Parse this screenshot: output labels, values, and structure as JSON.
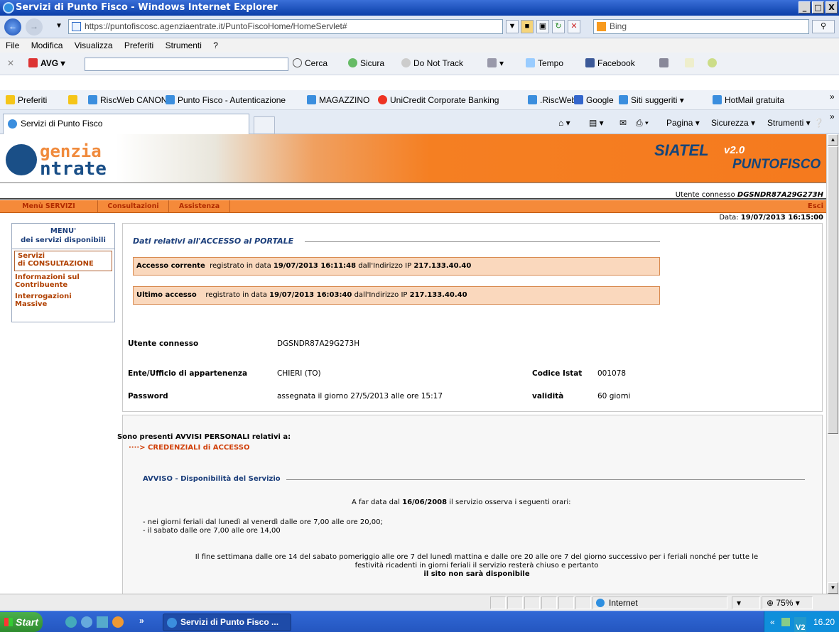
{
  "window": {
    "title": "Servizi di Punto Fisco - Windows Internet Explorer",
    "min": "_",
    "max": "×",
    "close": "X"
  },
  "browser": {
    "url": "https://puntofiscosc.agenziaentrate.it/PuntoFiscoHome/HomeServlet#",
    "search_placeholder": "Bing",
    "menu": [
      "File",
      "Modifica",
      "Visualizza",
      "Preferiti",
      "Strumenti",
      "?"
    ],
    "avg": {
      "label": "AVG",
      "cerca": "Cerca",
      "sicura": "Sicura",
      "dnt": "Do Not Track",
      "tempo": "Tempo",
      "facebook": "Facebook"
    },
    "favorites": {
      "label": "Preferiti",
      "items": [
        "RiscWeb CANONI",
        "Punto Fisco - Autenticazione",
        "MAGAZZINO",
        "UniCredit Corporate Banking",
        ".RiscWeb",
        "Google",
        "Siti suggeriti ▾",
        "HotMail gratuita"
      ]
    },
    "tab": "Servizi di Punto Fisco",
    "commands": {
      "pagina": "Pagina ▾",
      "sicurezza": "Sicurezza ▾",
      "strumenti": "Strumenti ▾"
    }
  },
  "site": {
    "logo_top": "genzia",
    "logo_bottom": "ntrate",
    "brand_siatel": "SIATEL",
    "brand_version": "v2.0",
    "brand_punto": "PUNTOFISCO",
    "user_line_label": "Utente connesso",
    "user_line_value": "DGSNDR87A29G273H",
    "nav": [
      "Menù SERVIZI",
      "Consultazioni",
      "Assistenza"
    ],
    "esci": "Esci",
    "date_label": "Data:",
    "date_value": "19/07/2013 16:15:00"
  },
  "sidebar": {
    "title1": "MENU'",
    "title2": "dei servizi disponibili",
    "items": [
      {
        "line1": "Servizi",
        "line2": "di CONSULTAZIONE"
      },
      {
        "line1": "Informazioni sul",
        "line2": "Contribuente"
      },
      {
        "line1": "Interrogazioni",
        "line2": "Massive"
      }
    ]
  },
  "access": {
    "legend": "Dati relativi all'ACCESSO al PORTALE",
    "current": {
      "label": "Accesso corrente",
      "text": "registrato in data",
      "date": "19/07/2013 16:11:48",
      "ip_text": "dall'Indirizzo IP",
      "ip": "217.133.40.40"
    },
    "last": {
      "label": "Ultimo accesso",
      "text": "registrato in data",
      "date": "19/07/2013 16:03:40",
      "ip_text": "dall'Indirizzo IP",
      "ip": "217.133.40.40"
    }
  },
  "info": {
    "utente_label": "Utente connesso",
    "utente_value": "DGSNDR87A29G273H",
    "ente_label": "Ente/Ufficio di appartenenza",
    "ente_value": "CHIERI (TO)",
    "istat_label": "Codice Istat",
    "istat_value": "001078",
    "pwd_label": "Password",
    "pwd_value": "assegnata il giorno 27/5/2013 alle ore 15:17",
    "validita_label": "validità",
    "validita_value": "60 giorni"
  },
  "avvisi": {
    "heading": "Sono presenti AVVISI PERSONALI relativi a:",
    "link": "····> CREDENZIALI di ACCESSO",
    "legend": "AVVISO - Disponibilità del Servizio",
    "line1a": "A far data dal",
    "line1date": "16/06/2008",
    "line1b": "il servizio osserva i seguenti orari:",
    "bullet1": "- nei giorni feriali dal lunedì al venerdì dalle ore 7,00 alle ore 20,00;",
    "bullet2": "- il sabato dalle ore 7,00 alle ore 14,00",
    "para1": "Il fine settimana dalle ore 14 del sabato pomeriggio alle ore 7 del lunedì mattina e dalle ore 20 alle ore 7 del giorno successivo per i feriali nonché per tutte le",
    "para2": "festività ricadenti in giorni feriali il servizio resterà chiuso e pertanto",
    "para3": "il sito non sarà disponibile"
  },
  "status": {
    "zone": "Internet",
    "zoom": "75%"
  },
  "taskbar": {
    "start": "Start",
    "task": "Servizi di Punto Fisco ...",
    "clock": "16.20",
    "chevron": "»",
    "tray_chevron": "«"
  },
  "colors": {
    "orange": "#f58a3a",
    "navy": "#1a3d7a",
    "highlight": "#fad8bd",
    "titlebar": "#0a3ea8"
  }
}
